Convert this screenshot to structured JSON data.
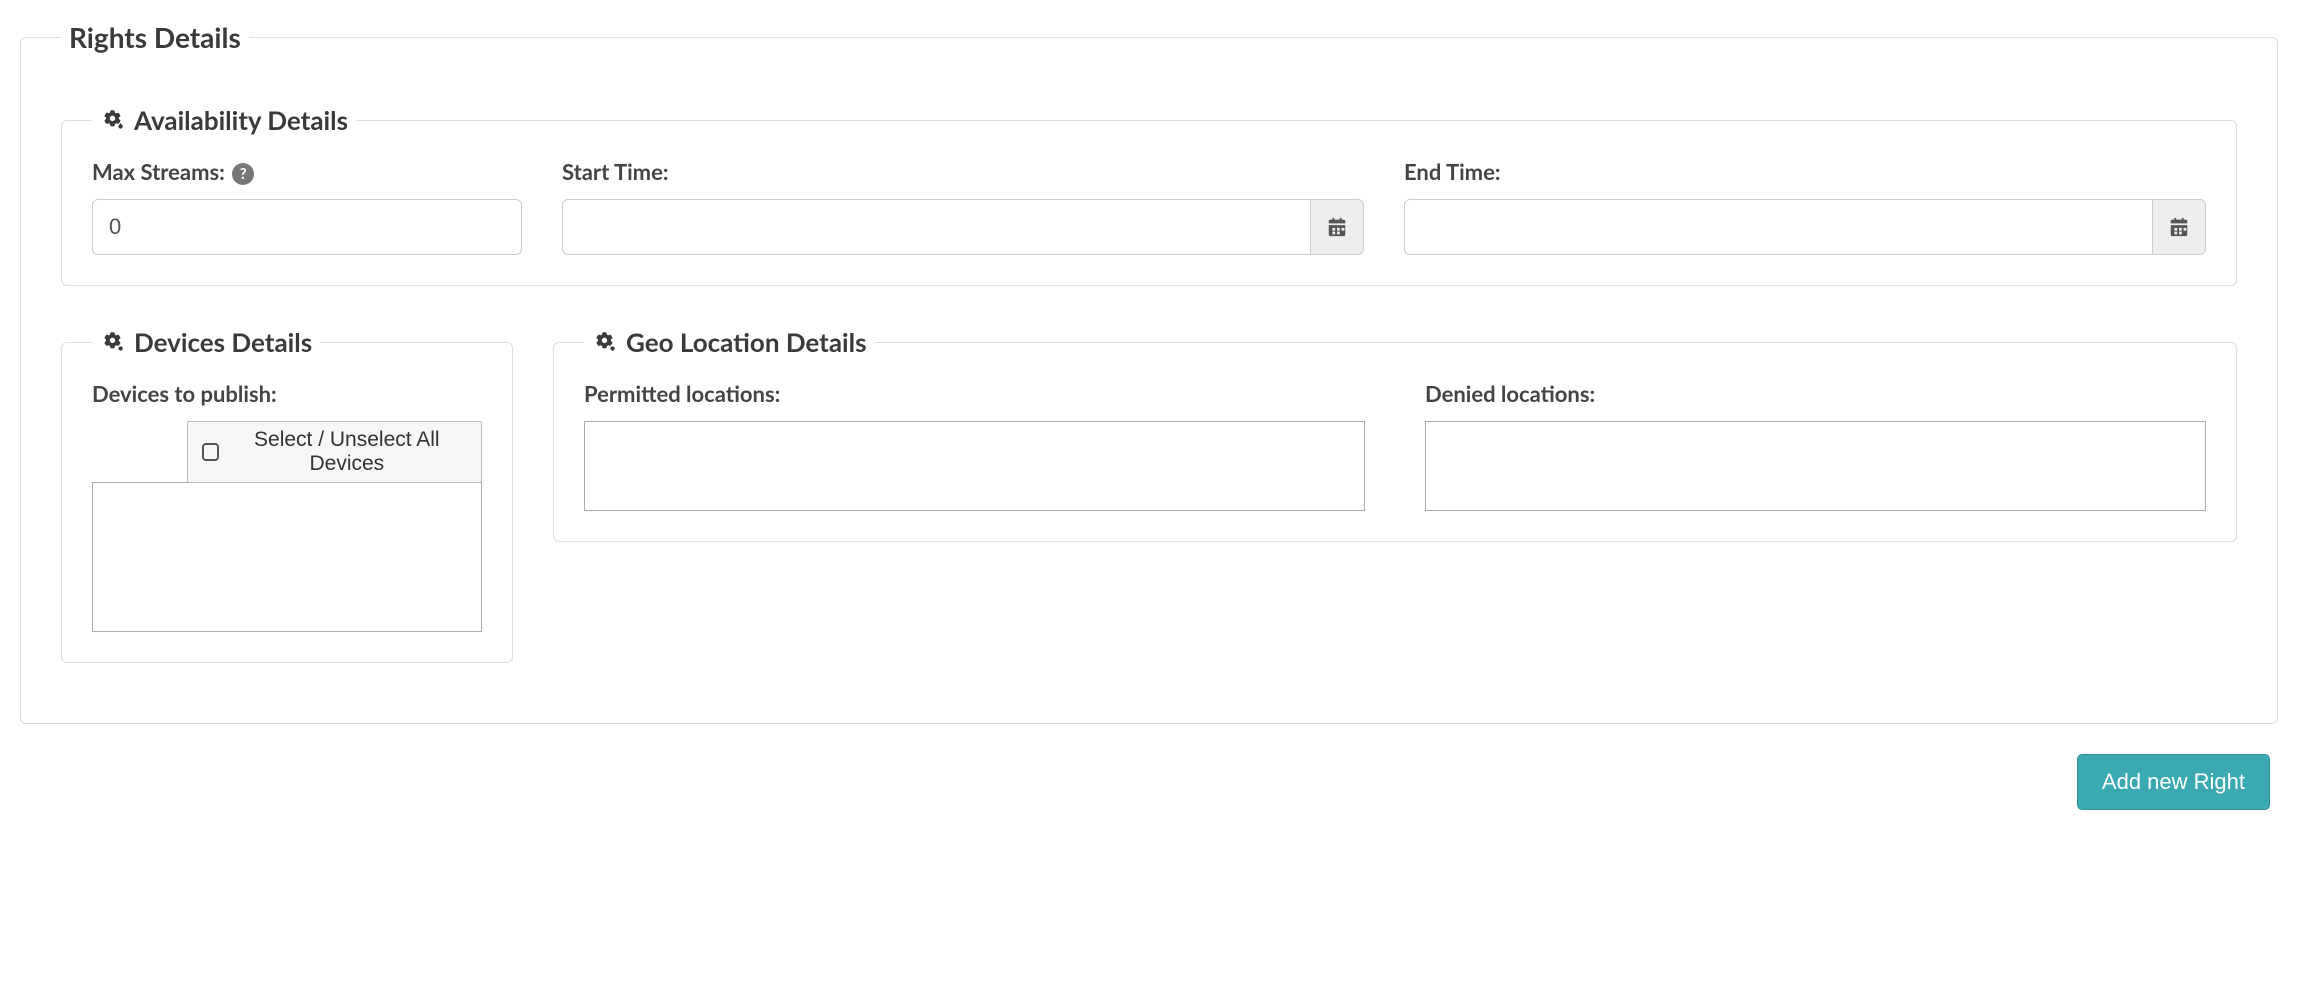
{
  "rights": {
    "legend": "Rights Details",
    "availability": {
      "legend": "Availability Details",
      "maxStreams": {
        "label": "Max Streams:",
        "value": "0"
      },
      "startTime": {
        "label": "Start Time:",
        "value": ""
      },
      "endTime": {
        "label": "End Time:",
        "value": ""
      }
    },
    "devices": {
      "legend": "Devices Details",
      "publishLabel": "Devices to publish:",
      "selectAllLabel": "Select / Unselect All Devices",
      "items": []
    },
    "geo": {
      "legend": "Geo Location Details",
      "permittedLabel": "Permitted locations:",
      "deniedLabel": "Denied locations:",
      "permitted": [],
      "denied": []
    }
  },
  "actions": {
    "addNewRight": "Add new Right"
  },
  "icons": {
    "gears": "gears-icon",
    "help": "?",
    "calendar": "calendar-icon"
  }
}
